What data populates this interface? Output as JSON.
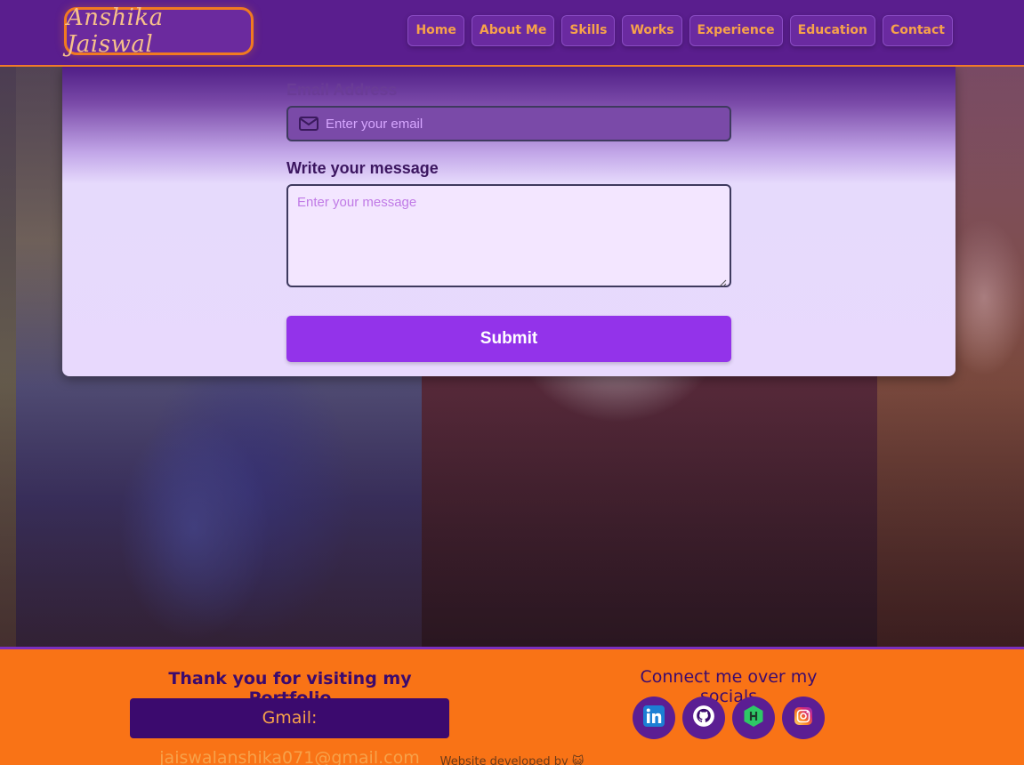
{
  "header": {
    "logo_text": "Anshika Jaiswal",
    "nav": [
      "Home",
      "About Me",
      "Skills",
      "Works",
      "Experience",
      "Education",
      "Contact"
    ]
  },
  "form": {
    "email_label": "Email Address",
    "email_placeholder": "Enter your email",
    "message_label": "Write your message",
    "message_placeholder": "Enter your message",
    "submit_label": "Submit"
  },
  "footer": {
    "thanks": "Thank you for visiting my Portfolio",
    "gmail": "Gmail: jaiswalanshika071@gmail.com",
    "connect": "Connect me over my socials",
    "socials": [
      {
        "name": "linkedin-icon",
        "color": "#0a66c2"
      },
      {
        "name": "github-icon",
        "color": "#ffffff"
      },
      {
        "name": "hackerrank-icon",
        "color": "#2ec866"
      },
      {
        "name": "instagram-icon",
        "color": "#e1306c"
      }
    ],
    "developed_by": "Website developed by 😺"
  },
  "colors": {
    "header_bg": "#5a1e8e",
    "accent_orange": "#f97316",
    "submit_purple": "#9333ea",
    "dark_purple": "#3b0a6e"
  }
}
